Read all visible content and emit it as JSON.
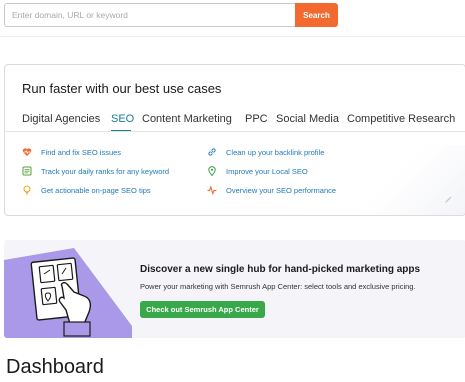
{
  "search": {
    "placeholder": "Enter domain, URL or keyword",
    "button_label": "Search"
  },
  "use_cases": {
    "title": "Run faster with our best use cases",
    "tabs": [
      {
        "label": "Digital Agencies",
        "active": false
      },
      {
        "label": "SEO",
        "active": true
      },
      {
        "label": "Content Marketing",
        "active": false
      },
      {
        "label": "PPC",
        "active": false
      },
      {
        "label": "Social Media",
        "active": false
      },
      {
        "label": "Competitive Research",
        "active": false
      }
    ],
    "items_left": [
      {
        "label": "Find and fix SEO issues",
        "icon": "heart-pulse-icon"
      },
      {
        "label": "Track your daily ranks for any keyword",
        "icon": "list-check-icon"
      },
      {
        "label": "Get actionable on-page SEO tips",
        "icon": "lightbulb-icon"
      }
    ],
    "items_right": [
      {
        "label": "Clean up your backlink profile",
        "icon": "link-icon"
      },
      {
        "label": "Improve your Local SEO",
        "icon": "map-pin-icon"
      },
      {
        "label": "Overview your SEO performance",
        "icon": "pulse-icon"
      }
    ]
  },
  "promo": {
    "title": "Discover a new single hub for hand-picked marketing apps",
    "text": "Power your marketing with Semrush App Center: select tools and exclusive pricing.",
    "button_label": "Check out Semrush App Center"
  },
  "page": {
    "title": "Dashboard"
  },
  "colors": {
    "accent_orange": "#f26a2f",
    "tab_active": "#1a7a96",
    "link_blue": "#2079b8",
    "cta_green": "#39a84a",
    "promo_bg": "#f5f4f9",
    "illustration_purple": "#a999e8"
  }
}
